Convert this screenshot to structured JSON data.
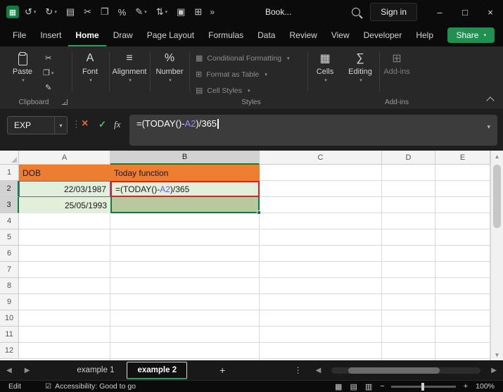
{
  "colors": {
    "excel_green": "#107C41",
    "share_green": "#1E9150",
    "header_orange": "#ED7D31",
    "cell_light_green": "#E2EFDA",
    "cell_sage": "#B7C99D",
    "annotation_red": "#E02020",
    "reference_purple": "#6A5ACD"
  },
  "icons": {
    "excel_logo": "▦",
    "undo": "↺",
    "redo": "↻",
    "print": "▤",
    "cut": "✂",
    "copy": "❐",
    "percent": "%",
    "format_painter": "✎",
    "sort": "⇅",
    "paste": "▣",
    "borders": "⊞",
    "more": "»",
    "chevron": "▾",
    "cancel": "×",
    "enter": "✓",
    "fx": "fx",
    "dots": "⋮",
    "left_arrow": "◀",
    "right_arrow": "▶",
    "up_arrow": "▲",
    "down_arrow": "▼",
    "plus": "+",
    "minimize": "–",
    "maximize": "□",
    "close": "×",
    "view_normal": "▦",
    "view_layout": "▤",
    "view_break": "▥",
    "zoom_minus": "−",
    "zoom_plus": "+",
    "accessibility": "☑",
    "font": "A",
    "alignment": "≡",
    "number": "%",
    "cond_format": "▦",
    "format_table": "⊞",
    "cell_styles": "▤",
    "cells": "▦",
    "editing": "∑",
    "addins": "⊞"
  },
  "titlebar": {
    "workbook_name": "Book...",
    "sign_in": "Sign in"
  },
  "menu": {
    "tabs": [
      "File",
      "Insert",
      "Home",
      "Draw",
      "Page Layout",
      "Formulas",
      "Data",
      "Review",
      "View",
      "Developer",
      "Help"
    ],
    "active": "Home",
    "share": "Share"
  },
  "ribbon": {
    "paste": "Paste",
    "font": "Font",
    "alignment": "Alignment",
    "number": "Number",
    "styles_buttons": [
      "Conditional Formatting",
      "Format as Table",
      "Cell Styles"
    ],
    "cells": "Cells",
    "editing": "Editing",
    "addins": "Add-ins",
    "group_labels": {
      "clipboard": "Clipboard",
      "styles": "Styles",
      "addins": "Add-ins"
    }
  },
  "formula_bar": {
    "name_box": "EXP",
    "formula": {
      "prefix": "=(TODAY()-",
      "ref": "A2",
      "suffix": ")/365",
      "full": "=(TODAY()-A2)/365"
    }
  },
  "grid": {
    "columns": [
      "A",
      "B",
      "C",
      "D",
      "E"
    ],
    "rows": [
      "1",
      "2",
      "3",
      "4",
      "5",
      "6",
      "7",
      "8",
      "9",
      "10",
      "11",
      "12"
    ],
    "cells": {
      "A1": "DOB",
      "B1": "Today function",
      "A2": "22/03/1987",
      "A3": "25/05/1993"
    }
  },
  "sheet_tabs": {
    "tabs": [
      "example 1",
      "example 2"
    ],
    "active": "example 2"
  },
  "status_bar": {
    "mode": "Edit",
    "accessibility": "Accessibility: Good to go",
    "zoom": "100%"
  }
}
